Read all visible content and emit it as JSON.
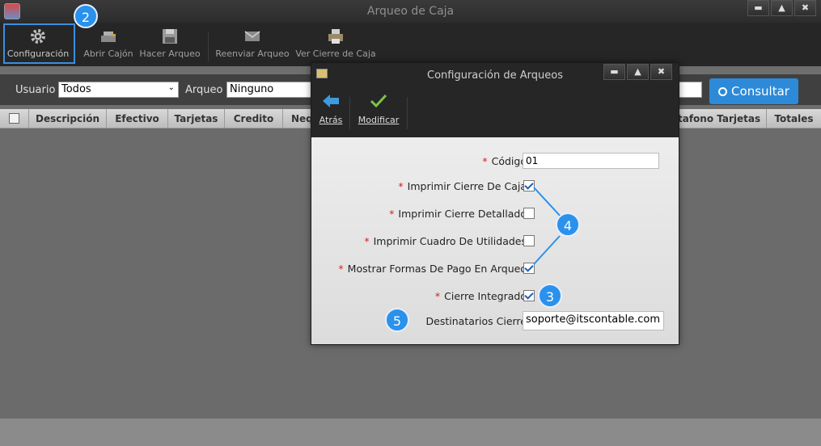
{
  "window": {
    "title": "Arqueo de Caja",
    "min": "▬",
    "max": "▲",
    "close": "✖"
  },
  "toolbar": {
    "items": [
      {
        "label": "Configuración",
        "icon": "gear-icon"
      },
      {
        "label": "Abrir Cajón",
        "icon": "drawer-icon"
      },
      {
        "label": "Hacer Arqueo",
        "icon": "save-icon"
      },
      {
        "label": "Reenviar Arqueo",
        "icon": "envelope-icon"
      },
      {
        "label": "Ver Cierre de Caja",
        "icon": "printer-icon"
      }
    ]
  },
  "filters": {
    "usuario_label": "Usuario",
    "usuario_value": "Todos",
    "arqueo_label": "Arqueo",
    "arqueo_value": "Ninguno",
    "consultar_label": "Consultar"
  },
  "grid": {
    "columns": [
      "Descripción",
      "Efectivo",
      "Tarjetas",
      "Credito",
      "Neq",
      "tafono Tarjetas",
      "Totales"
    ]
  },
  "dialog": {
    "title": "Configuración de Arqueos",
    "back_label": "Atrás",
    "modify_label": "Modificar",
    "fields": {
      "codigo_label": "Código",
      "codigo_value": "01",
      "imprimir_cierre_label": "Imprimir Cierre De Caja",
      "imprimir_cierre_checked": true,
      "imprimir_detallado_label": "Imprimir Cierre Detallado",
      "imprimir_detallado_checked": false,
      "imprimir_cuadro_label": "Imprimir Cuadro De Utilidades",
      "imprimir_cuadro_checked": false,
      "mostrar_formas_label": "Mostrar Formas De Pago En Arqueo",
      "mostrar_formas_checked": true,
      "cierre_integrado_label": "Cierre Integrado",
      "cierre_integrado_checked": true,
      "destinatarios_label": "Destinatarios Cierre",
      "destinatarios_value": "soporte@itscontable.com"
    },
    "required_mark": "*"
  },
  "annotations": [
    "2",
    "3",
    "4",
    "5"
  ],
  "colors": {
    "accent": "#2a91ec",
    "highlight": "#3a8fe0",
    "required": "#d42020"
  }
}
